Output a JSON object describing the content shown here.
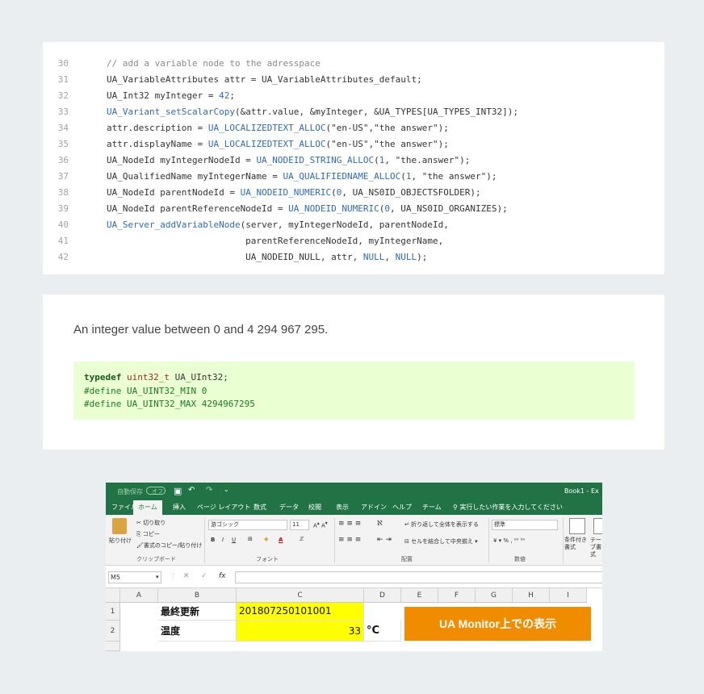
{
  "code": {
    "line_numbers": [
      "30",
      "31",
      "32",
      "33",
      "34",
      "35",
      "36",
      "37",
      "38",
      "39",
      "40",
      "41",
      "42"
    ],
    "lines": [
      "// add a variable node to the adresspace",
      "UA_VariableAttributes attr = UA_VariableAttributes_default;",
      "UA_Int32 myInteger = 42;",
      "UA_Variant_setScalarCopy(&attr.value, &myInteger, &UA_TYPES[UA_TYPES_INT32]);",
      "attr.description = UA_LOCALIZEDTEXT_ALLOC(\"en-US\",\"the answer\");",
      "attr.displayName = UA_LOCALIZEDTEXT_ALLOC(\"en-US\",\"the answer\");",
      "UA_NodeId myIntegerNodeId = UA_NODEID_STRING_ALLOC(1, \"the.answer\");",
      "UA_QualifiedName myIntegerName = UA_QUALIFIEDNAME_ALLOC(1, \"the answer\");",
      "UA_NodeId parentNodeId = UA_NODEID_NUMERIC(0, UA_NS0ID_OBJECTSFOLDER);",
      "UA_NodeId parentReferenceNodeId = UA_NODEID_NUMERIC(0, UA_NS0ID_ORGANIZES);",
      "UA_Server_addVariableNode(server, myIntegerNodeId, parentNodeId,",
      "                          parentReferenceNodeId, myIntegerName,",
      "                          UA_NODEID_NULL, attr, NULL, NULL);"
    ]
  },
  "description": "An integer value between 0 and 4 294 967 295.",
  "typedef_lines": [
    "typedef uint32_t UA_UInt32;",
    "#define UA_UINT32_MIN 0",
    "#define UA_UINT32_MAX 4294967295"
  ],
  "excel": {
    "autosave_label": "自動保存",
    "autosave_state": "オフ",
    "book_title": "Book1 - Ex",
    "tabs": [
      "ファイル",
      "ホーム",
      "挿入",
      "ページ レイアウト",
      "数式",
      "データ",
      "校閲",
      "表示",
      "アドイン",
      "ヘルプ",
      "チーム"
    ],
    "tell_me": "実行したい作業を入力してください",
    "ribbon": {
      "paste": "貼り付け",
      "cut": "切り取り",
      "copy": "コピー",
      "format_painter": "書式のコピー/貼り付け",
      "clipboard_group": "クリップボード",
      "font_name": "游ゴシック",
      "font_size": "11",
      "font_group": "フォント",
      "wrap_text": "折り返して全体を表示する",
      "merge_center": "セルを結合して中央揃え",
      "alignment_group": "配置",
      "number_format": "標準",
      "number_group": "数値",
      "conditional_format": "条件付き書式",
      "table_format": "テーブ書式"
    },
    "name_box": "M5",
    "fx_label": "fx",
    "columns": [
      "A",
      "B",
      "C",
      "D",
      "E",
      "F",
      "G",
      "H",
      "I"
    ],
    "rows": [
      "1",
      "2"
    ],
    "cells": {
      "B1": "最終更新",
      "C1": "201807250101001",
      "B2": "温度",
      "C2": "33",
      "D2": "°C"
    },
    "banner": "UA Monitor上での表示",
    "colors": {
      "excel_green": "#217346",
      "highlight_yellow": "#ffff00",
      "banner_orange": "#f08c00"
    }
  }
}
